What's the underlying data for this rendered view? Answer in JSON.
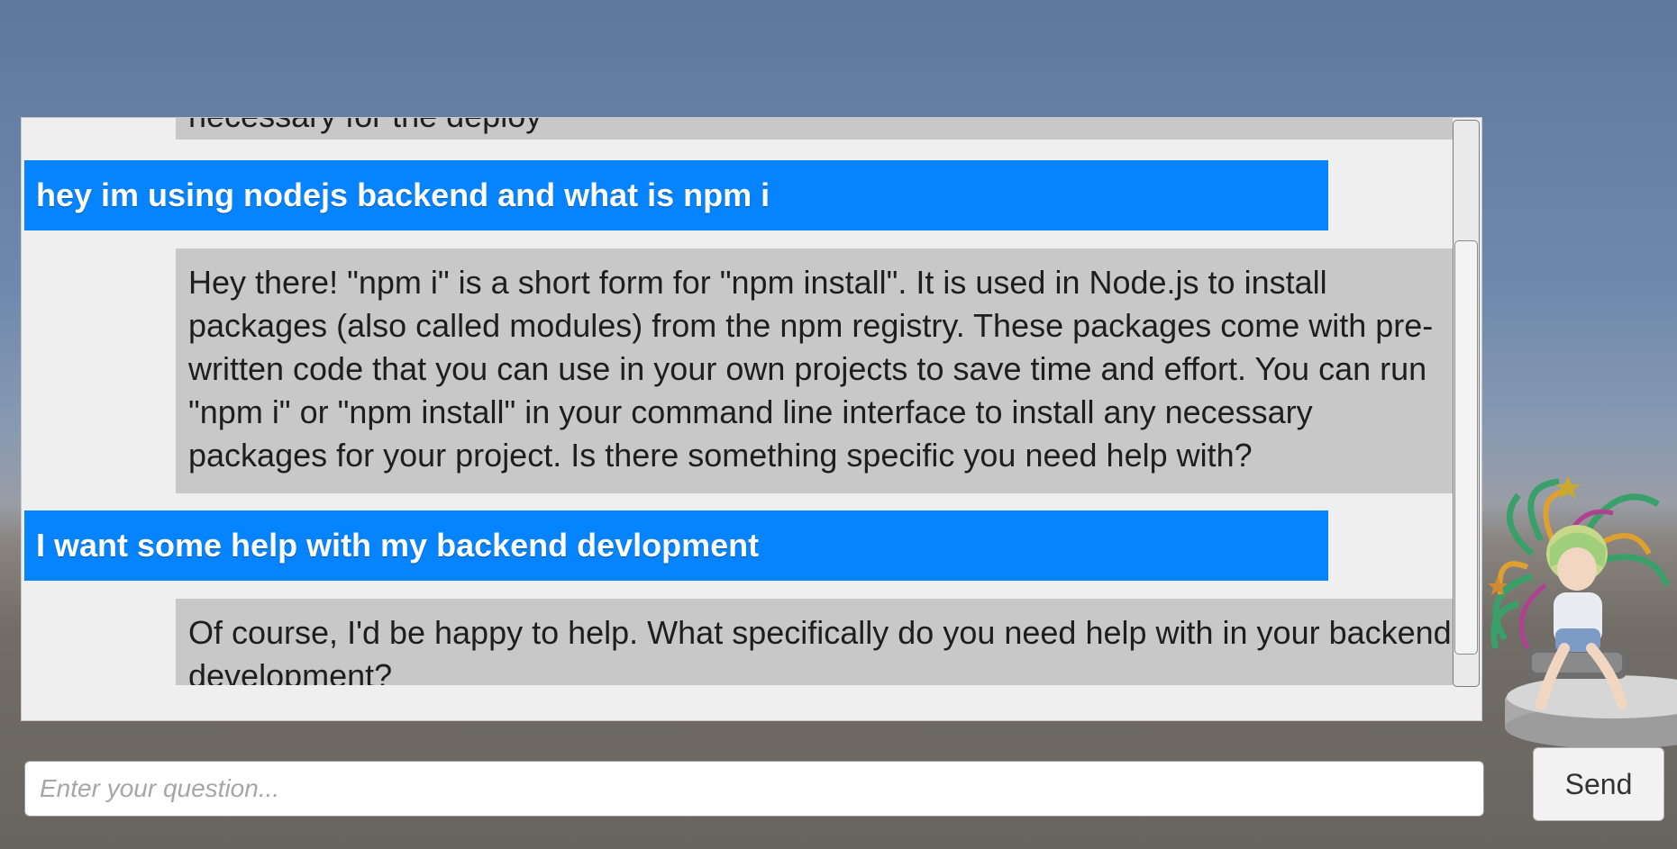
{
  "chat": {
    "messages": [
      {
        "role": "assistant",
        "text": "necessary for the deploy"
      },
      {
        "role": "user",
        "text": "hey im using nodejs backend and what is npm i"
      },
      {
        "role": "assistant",
        "text": "Hey there! \"npm i\" is a short form for \"npm install\". It is used in Node.js to install packages (also called modules) from the npm registry. These packages come with pre-written code that you can use in your own projects to save time and effort. You can run \"npm i\" or \"npm install\" in your command line interface to install any necessary packages for your project. Is there something specific you need help with?"
      },
      {
        "role": "user",
        "text": "I want some help with my backend devlopment"
      },
      {
        "role": "assistant",
        "text": "Of course, I'd be happy to help. What specifically do you need help with in your backend development?"
      }
    ]
  },
  "input": {
    "placeholder": "Enter your question...",
    "value": ""
  },
  "send_button": {
    "label": "Send"
  },
  "colors": {
    "user_bubble": "#0683ff",
    "assistant_bubble": "#c8c8c8",
    "panel": "#efefef",
    "sky": "#6f89ad",
    "ground": "#6d6762"
  },
  "scene": {
    "character": "anime-figure-on-pedestal"
  }
}
